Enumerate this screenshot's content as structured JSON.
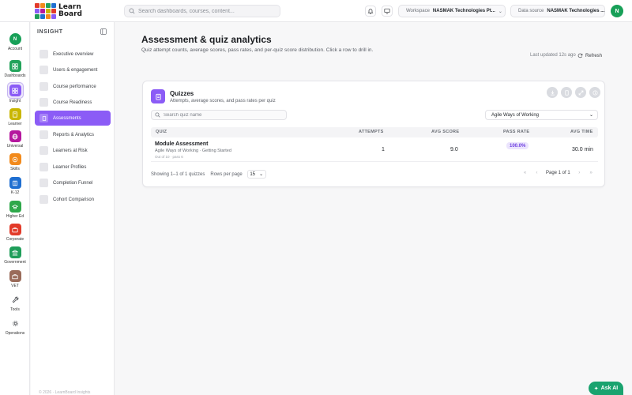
{
  "app": {
    "logo_line1": "Learn",
    "logo_line2": "Board",
    "user_initial": "N"
  },
  "topbar": {
    "search_placeholder": "Search dashboards, courses, content...",
    "workspace_label": "Workspace",
    "workspace_value": "NASMAK Technologies Pt...",
    "datasource_label": "Data source",
    "datasource_value": "NASMAK Technologies ..."
  },
  "rail": [
    {
      "label": "Account",
      "icon": "avatar",
      "color": "#18a058"
    },
    {
      "label": "Dashboards",
      "icon": "grid-icon",
      "color": "#22a35a"
    },
    {
      "label": "Insight",
      "icon": "insight-icon",
      "color": "#8b5cf6"
    },
    {
      "label": "Learner",
      "icon": "book-icon",
      "color": "#c9b600"
    },
    {
      "label": "Universal",
      "icon": "globe-icon",
      "color": "#b5179e"
    },
    {
      "label": "Skills",
      "icon": "star-icon",
      "color": "#f28a1c"
    },
    {
      "label": "K-12",
      "icon": "school-icon",
      "color": "#1f6fd1"
    },
    {
      "label": "Higher Ed",
      "icon": "grad-cap-icon",
      "color": "#2ea84a"
    },
    {
      "label": "Corporate",
      "icon": "briefcase-icon",
      "color": "#e23b2a"
    },
    {
      "label": "Government",
      "icon": "building-icon",
      "color": "#1f9e5a"
    },
    {
      "label": "VET",
      "icon": "toolbox-icon",
      "color": "#9a6b5a"
    },
    {
      "label": "Tools",
      "icon": "wrench-icon",
      "color": "#ffffff"
    },
    {
      "label": "Operations",
      "icon": "settings-icon",
      "color": "#ffffff"
    }
  ],
  "sidebar": {
    "heading": "INSIGHT",
    "items": [
      {
        "label": "Executive overview"
      },
      {
        "label": "Users & engagement"
      },
      {
        "label": "Course performance"
      },
      {
        "label": "Course Readiness"
      },
      {
        "label": "Assessments"
      },
      {
        "label": "Reports & Analytics"
      },
      {
        "label": "Learners at Risk"
      },
      {
        "label": "Learner Profiles"
      },
      {
        "label": "Completion Funnel"
      },
      {
        "label": "Cohort Comparison"
      }
    ],
    "footer": "© 2026 · LearnBoard Insights"
  },
  "main": {
    "title": "Assessment & quiz analytics",
    "description": "Quiz attempt counts, average scores, pass rates, and per-quiz score distribution. Click a row to drill in.",
    "updated": "Last updated 12s ago",
    "refresh_label": "Refresh"
  },
  "card": {
    "title": "Quizzes",
    "subtitle": "Attempts, average scores, and pass rates per quiz",
    "search_placeholder": "Search quiz name",
    "course_select": "Agile Ways of Working",
    "columns": {
      "quiz": "QUIZ",
      "attempts": "ATTEMPTS",
      "avg_score": "AVG SCORE",
      "pass_rate": "PASS RATE",
      "avg_time": "AVG TIME"
    },
    "rows": [
      {
        "name": "Module Assessment",
        "course": "Agile Ways of Working · Getting Started",
        "meta": "Out of 10 · pass 6",
        "attempts": "1",
        "avg_score": "9.0",
        "pass_rate": "100.0%",
        "avg_time": "30.0 min"
      }
    ],
    "showing": "Showing 1–1 of 1 quizzes",
    "rows_per_page_label": "Rows per page",
    "rows_per_page": "15",
    "page_label": "Page 1 of 1"
  },
  "ask_ai": "Ask AI"
}
